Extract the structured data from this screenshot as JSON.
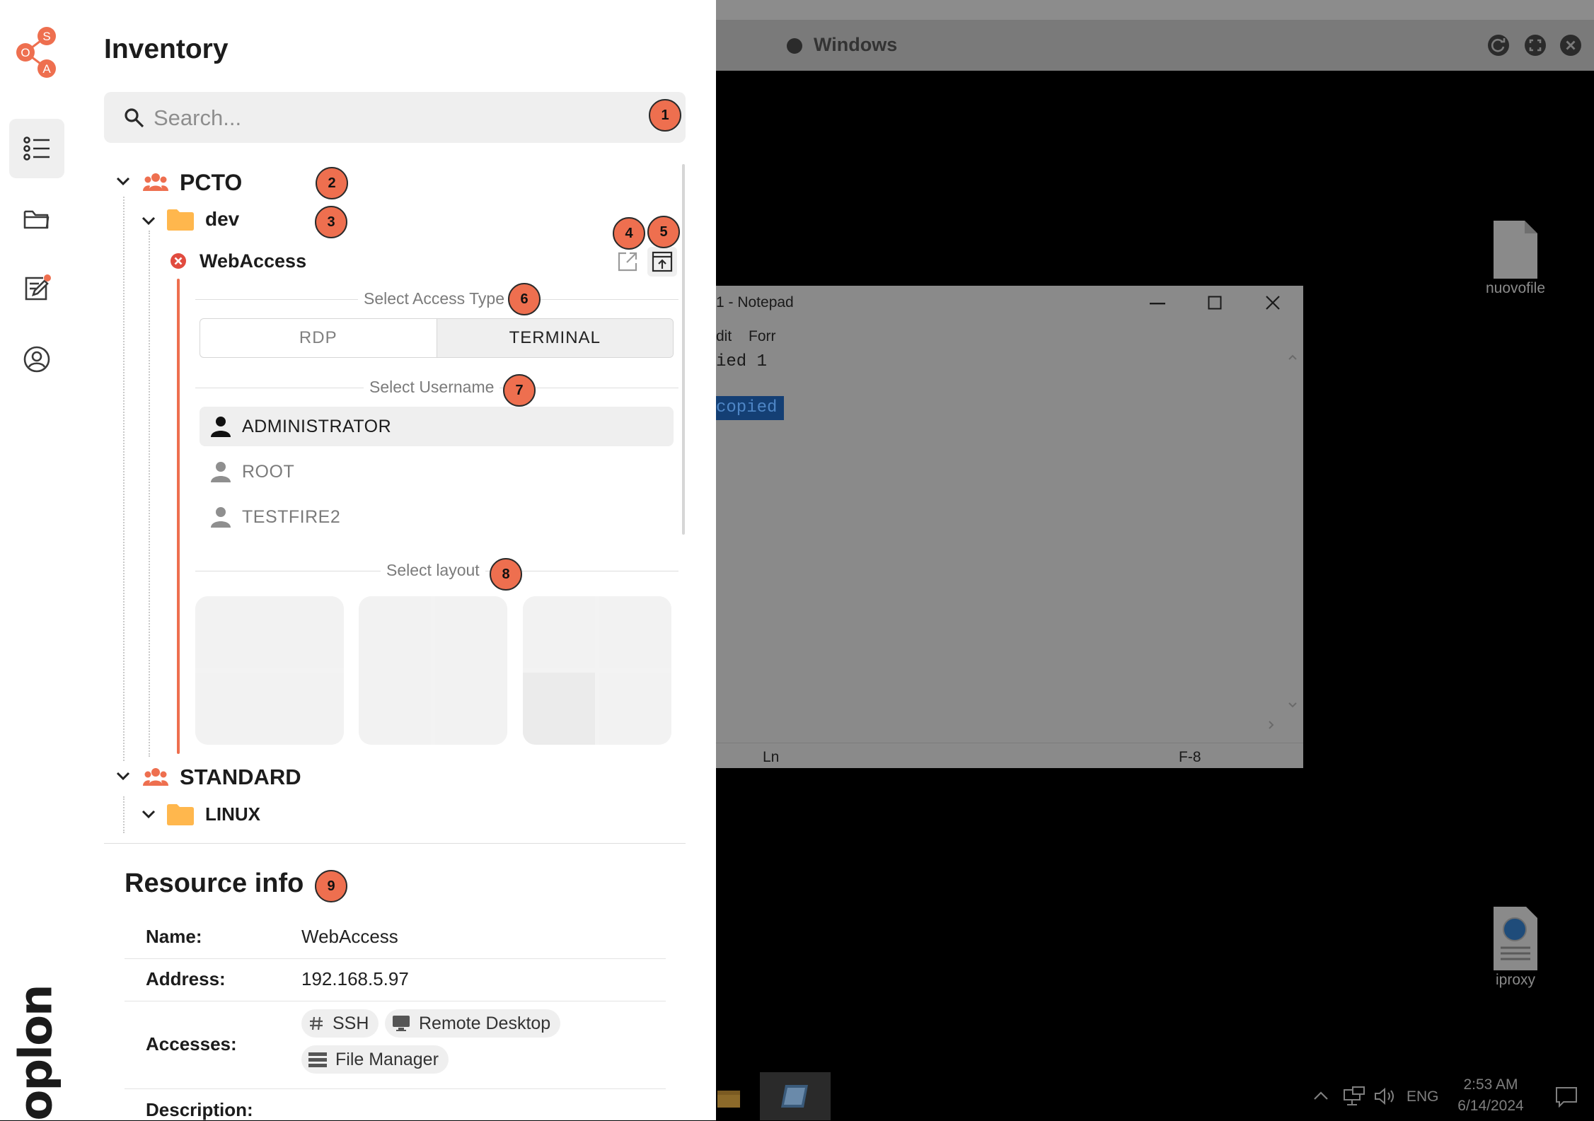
{
  "brand": {
    "logo_letters": [
      "O",
      "S",
      "A"
    ],
    "vertical_logo": "oplon"
  },
  "colors": {
    "accent": "#ee6f4f",
    "folder": "#ffb74d"
  },
  "panel": {
    "title": "Inventory",
    "search": {
      "placeholder": "Search..."
    }
  },
  "badges": [
    "1",
    "2",
    "3",
    "4",
    "5",
    "6",
    "7",
    "8",
    "9"
  ],
  "tree": {
    "group1": "PCTO",
    "folder1": "dev",
    "resource": "WebAccess",
    "group2": "STANDARD",
    "folder2": "LINUX"
  },
  "access": {
    "section_label": "Select Access Type",
    "types": [
      "RDP",
      "TERMINAL"
    ],
    "selected": "TERMINAL"
  },
  "username": {
    "section_label": "Select Username",
    "users": [
      "ADMINISTRATOR",
      "ROOT",
      "TESTFIRE2"
    ],
    "selected": "ADMINISTRATOR"
  },
  "layout": {
    "section_label": "Select layout"
  },
  "resource_info": {
    "title": "Resource info",
    "name_label": "Name:",
    "name": "WebAccess",
    "address_label": "Address:",
    "address": "192.168.5.97",
    "accesses_label": "Accesses:",
    "accesses": [
      "SSH",
      "Remote Desktop",
      "File Manager"
    ],
    "description_label": "Description:"
  },
  "remote": {
    "window_title": "Windows",
    "notepad": {
      "title": "1 - Notepad",
      "menu": [
        "dit",
        "Forr"
      ],
      "line1": "ied 1",
      "selected_text": "copied",
      "status_ln": "Ln",
      "status_enc": "F-8"
    },
    "desktop_icons": [
      "nuovofile",
      "iproxy"
    ],
    "tray": {
      "lang": "ENG",
      "time": "2:53 AM",
      "date": "6/14/2024"
    }
  }
}
